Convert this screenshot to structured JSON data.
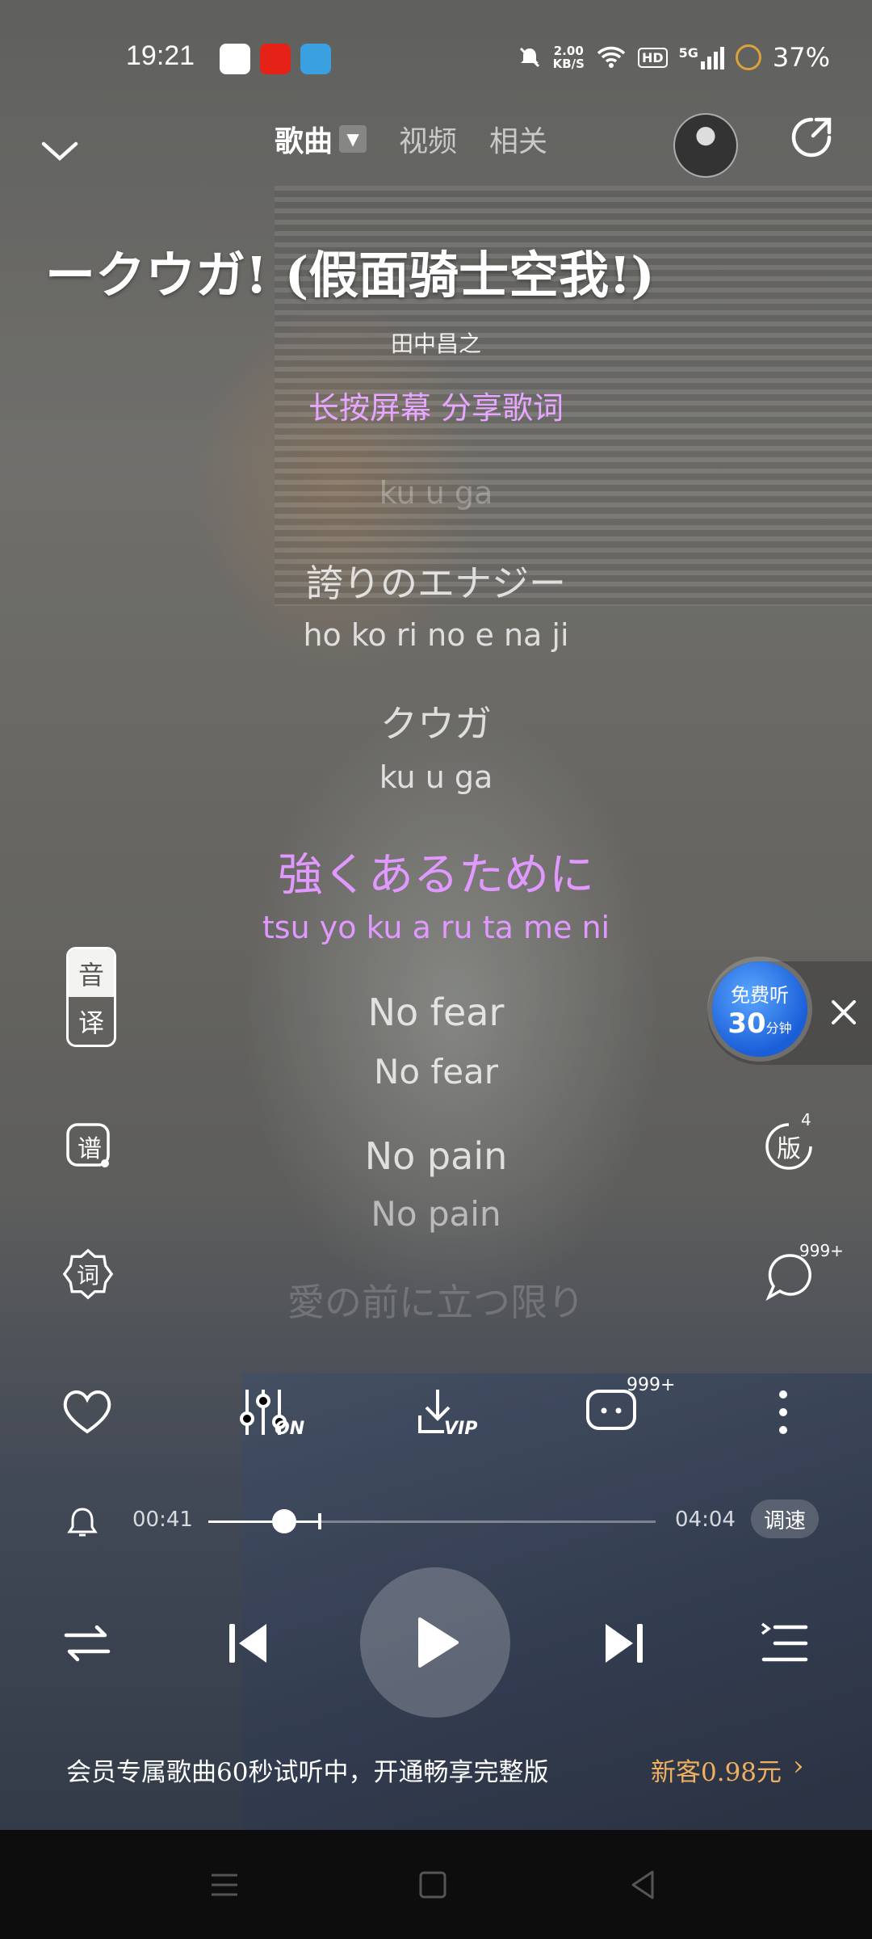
{
  "status_bar": {
    "time": "19:21",
    "net_speed_value": "2.00",
    "net_speed_unit": "KB/S",
    "hd_label": "HD",
    "signal_label": "5G",
    "battery": "37%"
  },
  "nav": {
    "tab_song": "歌曲",
    "tab_video": "视频",
    "tab_related": "相关"
  },
  "song": {
    "title": "ークウガ! (假面骑士空我!)",
    "artist": "田中昌之",
    "hint": "长按屏幕 分享歌词"
  },
  "lyrics": [
    {
      "romaji": "ku  u  ga",
      "state": "faint"
    },
    {
      "jp": "誇りのエナジー",
      "romaji": "ho ko  ri  no  e  na  ji",
      "state": "dim"
    },
    {
      "jp": "クウガ",
      "romaji": "ku  u  ga",
      "state": "dim"
    },
    {
      "jp": "強くあるために",
      "romaji": "tsu yo  ku  a  ru  ta  me  ni",
      "state": "active"
    },
    {
      "jp": "No fear",
      "romaji": "No  fear",
      "state": "dim"
    },
    {
      "jp": "No pain",
      "romaji": "No  pain",
      "state": "dim"
    },
    {
      "jp": "愛の前に立つ限り",
      "state": "faint"
    }
  ],
  "side": {
    "yin": "音",
    "yi": "译",
    "pu": "谱",
    "ci": "词",
    "ban": "版",
    "ban_count": "4",
    "comment_count": "999+"
  },
  "free": {
    "label": "免费听",
    "minutes": "30",
    "unit": "分钟"
  },
  "actions": {
    "fx_label": "ON",
    "download_label": "VIP",
    "comments_count": "999+"
  },
  "progress": {
    "current": "00:41",
    "total": "04:04",
    "position_fraction": 0.17,
    "trial_end_fraction": 0.246,
    "speed_label": "调速"
  },
  "vip_bar": {
    "message": "会员专属歌曲60秒试听中，开通畅享完整版",
    "price": "新客0.98元",
    "arrow": "›"
  },
  "colors": {
    "lyric_active": "#e198ff",
    "vip_price": "#f0b060",
    "free_badge": "#1a5ed8"
  }
}
